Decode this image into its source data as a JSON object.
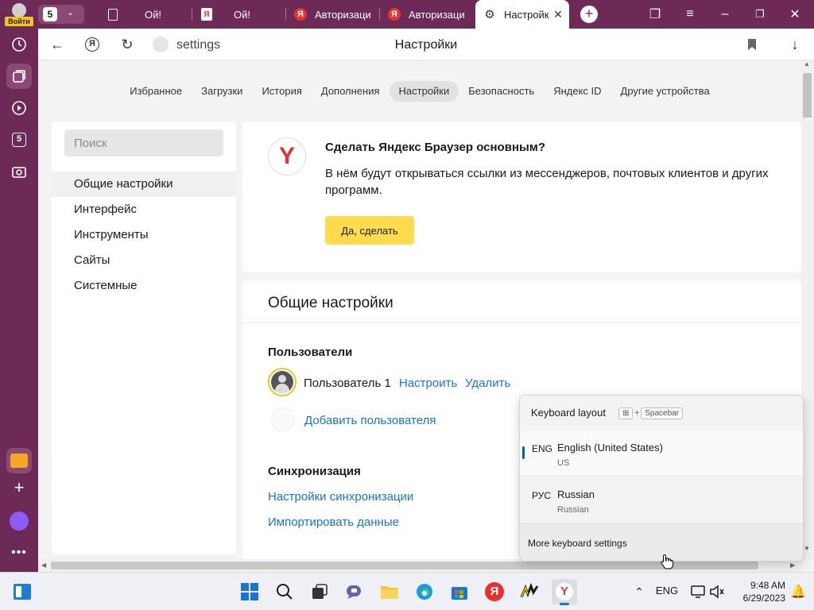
{
  "tabs": {
    "profile_label": "Войти",
    "counter": "5",
    "items": [
      {
        "title": "Ой!",
        "icon": "page-icon"
      },
      {
        "title": "Ой!",
        "icon": "pdf-icon"
      },
      {
        "title": "Авторизаци",
        "icon": "yandex-icon"
      },
      {
        "title": "Авторизаци",
        "icon": "yandex-icon"
      },
      {
        "title": "Настройк",
        "icon": "gear-icon",
        "active": true
      }
    ]
  },
  "toolbar": {
    "address": "settings",
    "page_title": "Настройки"
  },
  "topnav": [
    "Избранное",
    "Загрузки",
    "История",
    "Дополнения",
    "Настройки",
    "Безопасность",
    "Яндекс ID",
    "Другие устройства"
  ],
  "topnav_active": "Настройки",
  "sidebar_menu": {
    "search_placeholder": "Поиск",
    "items": [
      "Общие настройки",
      "Интерфейс",
      "Инструменты",
      "Сайты",
      "Системные"
    ],
    "active": "Общие настройки"
  },
  "promo": {
    "title": "Сделать Яндекс Браузер основным?",
    "text": "В нём будут открываться ссылки из мессенджеров, почтовых клиентов и других программ.",
    "button": "Да, сделать"
  },
  "general": {
    "title": "Общие настройки",
    "users_title": "Пользователи",
    "user_name": "Пользователь 1",
    "configure": "Настроить",
    "delete": "Удалить",
    "add_user": "Добавить пользователя",
    "sync_title": "Синхронизация",
    "sync_settings": "Настройки синхронизации",
    "import_data": "Импортировать данные"
  },
  "keyboard_flyout": {
    "title": "Keyboard layout",
    "shortcut_plus": "+",
    "shortcut_key": "Spacebar",
    "languages": [
      {
        "code": "ENG",
        "name": "English (United States)",
        "layout": "US",
        "selected": true
      },
      {
        "code": "РУС",
        "name": "Russian",
        "layout": "Russian",
        "selected": false
      }
    ],
    "more": "More keyboard settings"
  },
  "taskbar": {
    "input_indicator": "ENG",
    "time": "9:48 AM",
    "date": "6/29/2023"
  },
  "colors": {
    "browser_frame": "#6e2a57",
    "link": "#1a73c8",
    "primary_button": "#ffdb4d",
    "yandex_red": "#e8312f",
    "flyout_accent": "#005fb8"
  }
}
